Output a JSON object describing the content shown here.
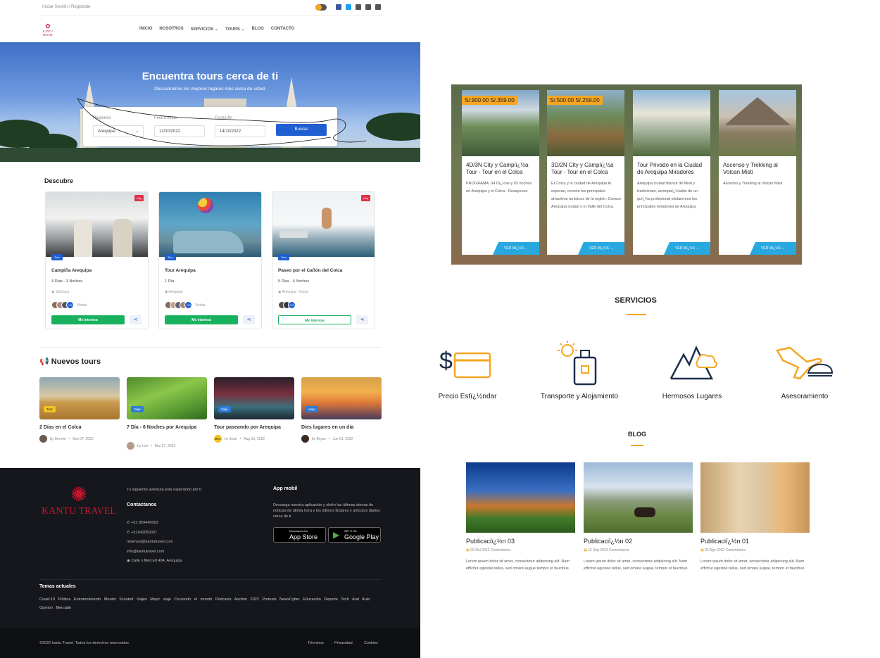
{
  "top": {
    "login": "Iniciar Sesión / Registrate"
  },
  "nav": {
    "items": [
      "INICIO",
      "NOSOTROS",
      "SERVICIOS ⌄",
      "TOURS ⌄",
      "BLOG",
      "CONTACTO"
    ],
    "logo_text": "KANTU TRAVEL"
  },
  "hero": {
    "title": "Encuentra tours cerca de ti",
    "subtitle": "Descubramos los mejores lugares más cerca de usted.",
    "region_label": "Regiones",
    "region_value": "Arequipa",
    "start_label": "Fecha inicio",
    "start_value": "12/10/2022",
    "end_label": "Fecha fin",
    "end_value": "14/10/2022",
    "search_btn": "Buscar"
  },
  "discover": {
    "title": "Descubre",
    "cards": [
      {
        "title": "Campiña Arequipa",
        "hoy": "Hoy",
        "tag": "Tour",
        "duration": "4 Días - 3 Noches",
        "loc": "Sachaca",
        "more": "+20",
        "visits": "Visitas",
        "btn": "Me interesa"
      },
      {
        "title": "Tour Arequipa",
        "hoy": "",
        "tag": "Tour",
        "duration": "1 Día",
        "loc": "Arequipa",
        "more": "+20",
        "visits": "Visitas",
        "btn": "Me interesa"
      },
      {
        "title": "Paseo por el Cañón del Colca",
        "hoy": "Hoy",
        "tag": "Tour",
        "duration": "5 Días - 4 Noches",
        "loc": "Arequipa - Colca",
        "more": "+20",
        "visits": "",
        "btn": "Me interesa"
      }
    ]
  },
  "new_tours": {
    "title": "Nuevos tours",
    "items": [
      {
        "title": "2 Días en el Colca",
        "badge": "Tour",
        "author": "by Dennis",
        "date": "Sep 07, 2022"
      },
      {
        "title": "7 Día - 6 Noches por Arequipa",
        "badge": "Viaje",
        "author": "by Lori",
        "date": "Mar 07, 2022"
      },
      {
        "title": "Tour paseando por Arequipa",
        "badge": "Viaje",
        "author": "by Joan",
        "date": "Aug 15, 2022",
        "avatar_text": "MKC"
      },
      {
        "title": "Dies lugares en un día",
        "badge": "Viaje",
        "author": "by Bryan",
        "date": "Jun 01, 2022"
      }
    ]
  },
  "footer": {
    "brand": "KANTU TRAVEL",
    "tagline": "Tu siguiente aventura esta esperando por ti.",
    "contact_title": "Contactanos",
    "phone1": "+51 959445063",
    "phone2": "+51942059037",
    "email1": "reservas@kantutravel.com",
    "email2": "info@kantutravel.com",
    "address": "Calle s Merced 404, Arequipa",
    "app_title": "App mobil",
    "app_text": "Descarga nuestra aplicación y obtén las últimas alertas de noticias de última hora y los últimos titulares y artículos diarios cerca de ti.",
    "appstore_small": "Download on the",
    "appstore_big": "App Store",
    "play_small": "GET IT ON",
    "play_big": "Google Play",
    "topics_title": "Temas actuales",
    "topics": "Covid-19  Politica  Entretenimiento  Mundo  Scouted  Viajes  Mejor viaje  Cruzando el mundo  Podcasts  Auction 2022  Protests  NewsCyber  Educación  Deporte  Tech And Auto  Opinion  Mercado",
    "copyright": "©2022 kantu Travel. Todos los derechos reservados",
    "links": [
      "Términos",
      "Privacidad",
      "Cookies"
    ]
  },
  "promo": {
    "cards": [
      {
        "price": "S/.900.00 S/.359.00",
        "title": "4D/3N City y Campiï¿½a Tour - Tour en el Colca",
        "desc": "PROGRAMA: 04 Dï¿½as y 03 noches en Arequipa y el Colca - Desayunos",
        "more": "VER Mï¿½S →"
      },
      {
        "price": "S/.500.00 S/.259.00",
        "title": "3D/2N City y Campiï¿½a Tour - Tour en el Colca",
        "desc": "El Colca y la ciudad de Arequipa te esperan, conoce los principales atractivos turísticos de la región. Conoce Arequipa ciudad y el Valle del Colca.",
        "more": "VER Mï¿½S →"
      },
      {
        "price": "",
        "title": "Tour Privado en la Ciudad de Arequipa Miradores",
        "desc": "Arequipa ciudad blanca de Misti y tradiciones, acompaï¿½ados de un guï¿½a profesional visitaremos los principales miradores de Arequipa.",
        "more": "VER Mï¿½S →"
      },
      {
        "price": "",
        "title": "Ascenso y Trekking al Volcan Misti",
        "desc": "Ascenso y Trekking al Volcan Misti",
        "more": "VER Mï¿½S →"
      }
    ]
  },
  "services": {
    "title": "SERVICIOS",
    "items": [
      "Precio Estï¿½ndar",
      "Transporte y Alojamiento",
      "Hermosos Lugares",
      "Asesoramiento"
    ]
  },
  "blog": {
    "title": "BLOG",
    "posts": [
      {
        "title": "Publicaciï¿½n 03",
        "date": "02 Oct 2022  Comentarios",
        "text": "Lorem ipsum dolor sit amet, consectetur adipiscing elit. Nam efficitur egestas tellus, sed ornare augue tempor et faucibus."
      },
      {
        "title": "Publicaciï¿½n 02",
        "date": "12 Sep 2022  Comentarios",
        "text": "Lorem ipsum dolor sit amet, consectetur adipiscing elit. Nam efficitur egestas tellus, sed ornare augue, tempor et faucibus."
      },
      {
        "title": "Publicaciï¿½n 01",
        "date": "05 Ago 2022  Comentarios",
        "text": "Lorem ipsum dolor sit amet, consectetur adipiscing elit. Nam efficitur egestas tellus, sed ornare augue, tempor et faucibus."
      }
    ]
  },
  "colors": {
    "brand": "#c4172c",
    "primary": "#1f5fd1",
    "green": "#18b25f",
    "accent": "#f5a623",
    "sky": "#29a8e0"
  }
}
